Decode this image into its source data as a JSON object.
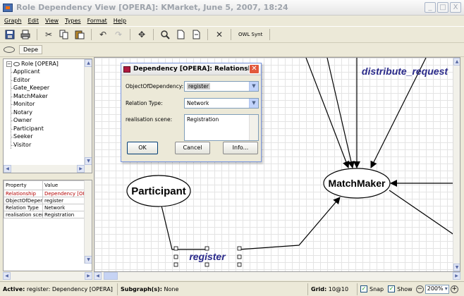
{
  "window": {
    "title": "Role Dependency View [OPERA]: KMarket, June 5, 2007, 18:24",
    "controls": [
      "_",
      "□",
      "X"
    ]
  },
  "menu": [
    "Graph",
    "Edit",
    "View",
    "Types",
    "Format",
    "Help"
  ],
  "toolbar": {
    "buttons": [
      "save-icon",
      "print-icon",
      "cut-icon",
      "copy-icon",
      "paste-icon",
      "undo-icon",
      "redo-icon",
      "move-icon",
      "zoom-icon",
      "new-page-icon",
      "page-icon",
      "delete-icon"
    ],
    "owl_sync_label": "OWL Synt"
  },
  "subtoolbar": {
    "tab_label": "Depe"
  },
  "tree": {
    "root": "Role [OPERA]",
    "items": [
      "Applicant",
      "Editor",
      "Gate_Keeper",
      "MatchMaker",
      "Monitor",
      "Notary",
      "Owner",
      "Participant",
      "Seeker",
      "Visitor"
    ]
  },
  "properties": {
    "headers": [
      "Property",
      "Value"
    ],
    "rows": [
      [
        "Relationship",
        "Dependency [OPERA]"
      ],
      [
        "ObjectOfDependency",
        "register"
      ],
      [
        "Relation Type",
        "Network"
      ],
      [
        "realisation scene",
        "Registration"
      ]
    ]
  },
  "canvas": {
    "nodes": {
      "participant": "Participant",
      "matchmaker": "MatchMaker"
    },
    "labels": {
      "register": "register",
      "distribute": "distribute_request"
    }
  },
  "dialog": {
    "title": "Dependency [OPERA]: Relationship",
    "fields": {
      "object_label": "ObjectOfDependency:",
      "object_value": "register",
      "relation_label": "Relation Type:",
      "relation_value": "Network",
      "scene_label": "realisation scene:",
      "scene_value": "Registration"
    },
    "buttons": {
      "ok": "OK",
      "cancel": "Cancel",
      "info": "Info..."
    }
  },
  "status": {
    "active_label": "Active:",
    "active_value": "register: Dependency [OPERA]",
    "subgraph_label": "Subgraph(s):",
    "subgraph_value": "None",
    "grid_label": "Grid:",
    "grid_value": "10@10",
    "snap_label": "Snap",
    "show_label": "Show",
    "zoom_value": "200%",
    "snap_checked": true,
    "show_checked": true
  }
}
